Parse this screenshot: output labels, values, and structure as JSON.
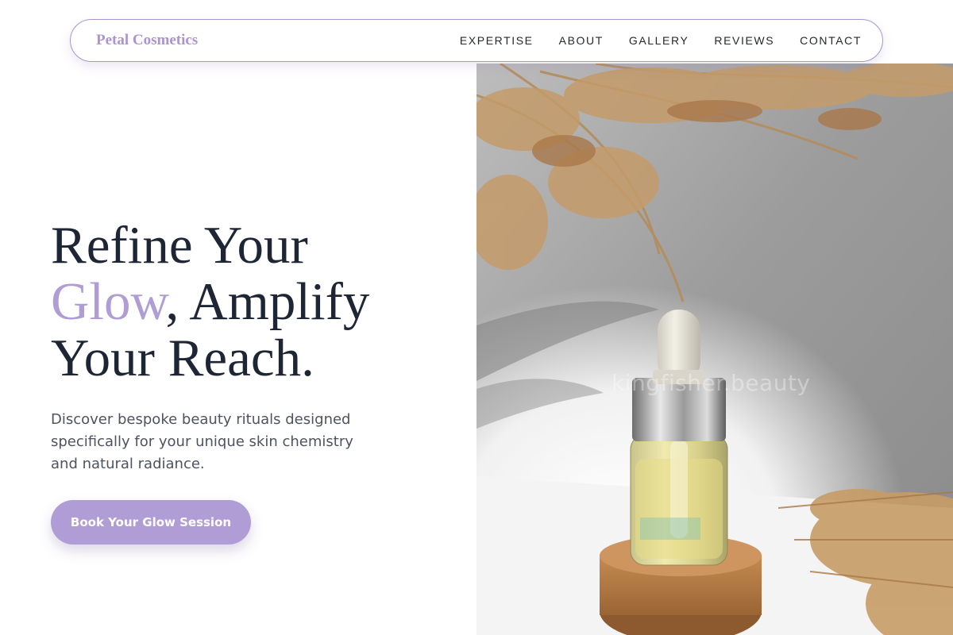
{
  "nav": {
    "brand": "Petal Cosmetics",
    "links": [
      "EXPERTISE",
      "ABOUT",
      "GALLERY",
      "REVIEWS",
      "CONTACT"
    ]
  },
  "hero": {
    "line1": "Refine Your",
    "accent_word": "Glow",
    "line2_rest": ", Amplify",
    "line3": "Your Reach.",
    "subtitle": "Discover bespoke beauty rituals designed specifically for your unique skin chemistry and natural radiance.",
    "cta_label": "Book Your Glow Session"
  },
  "photo": {
    "watermark": "kingfisher.beauty"
  },
  "colors": {
    "accent": "#b09dd6",
    "heading": "#1e2635",
    "body_text": "#4d5360",
    "nav_border": "#a996cf"
  }
}
